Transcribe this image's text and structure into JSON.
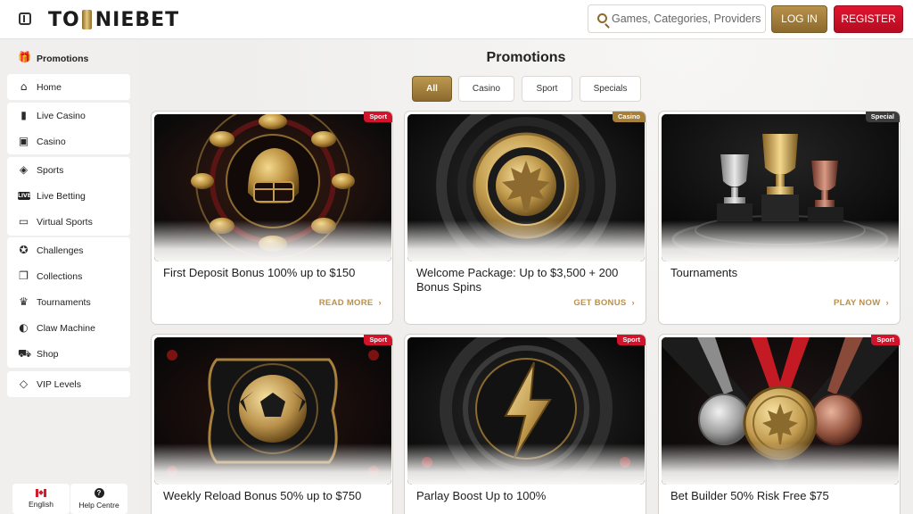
{
  "header": {
    "logo_left": "TO",
    "logo_right": "NIEBET",
    "search_placeholder": "Games, Categories, Providers",
    "login_label": "LOG IN",
    "register_label": "REGISTER"
  },
  "sidebar": {
    "promotions_label": "Promotions",
    "items": [
      {
        "label": "Home",
        "icon": "home-icon"
      },
      {
        "label": "Live Casino",
        "icon": "phone-card-icon"
      },
      {
        "label": "Casino",
        "icon": "slot-machine-icon"
      },
      {
        "label": "Sports",
        "icon": "football-icon"
      },
      {
        "label": "Live Betting",
        "icon": "live-icon"
      },
      {
        "label": "Virtual Sports",
        "icon": "monitor-icon"
      },
      {
        "label": "Challenges",
        "icon": "medal-icon"
      },
      {
        "label": "Collections",
        "icon": "cards-icon"
      },
      {
        "label": "Tournaments",
        "icon": "trophy-icon"
      },
      {
        "label": "Claw Machine",
        "icon": "claw-icon"
      },
      {
        "label": "Shop",
        "icon": "cart-icon"
      },
      {
        "label": "VIP Levels",
        "icon": "diamond-icon"
      }
    ],
    "language_label": "English",
    "help_label": "Help Centre"
  },
  "main": {
    "title": "Promotions",
    "filters": [
      "All",
      "Casino",
      "Sport",
      "Specials"
    ],
    "active_filter": "All",
    "cards": [
      {
        "title": "First Deposit Bonus 100% up to $150",
        "badge": "Sport",
        "cta": "READ MORE"
      },
      {
        "title": "Welcome Package: Up to $3,500 + 200 Bonus Spins",
        "badge": "Casino",
        "cta": "GET BONUS"
      },
      {
        "title": "Tournaments",
        "badge": "Special",
        "cta": "PLAY NOW"
      },
      {
        "title": "Weekly Reload Bonus 50% up to $750",
        "badge": "Sport",
        "cta": ""
      },
      {
        "title": "Parlay Boost Up to 100%",
        "badge": "Sport",
        "cta": ""
      },
      {
        "title": "Bet Builder 50% Risk Free $75",
        "badge": "Sport",
        "cta": ""
      }
    ]
  },
  "colors": {
    "gold": "#a8822f",
    "red": "#d1142b",
    "background": "#f0efed"
  }
}
